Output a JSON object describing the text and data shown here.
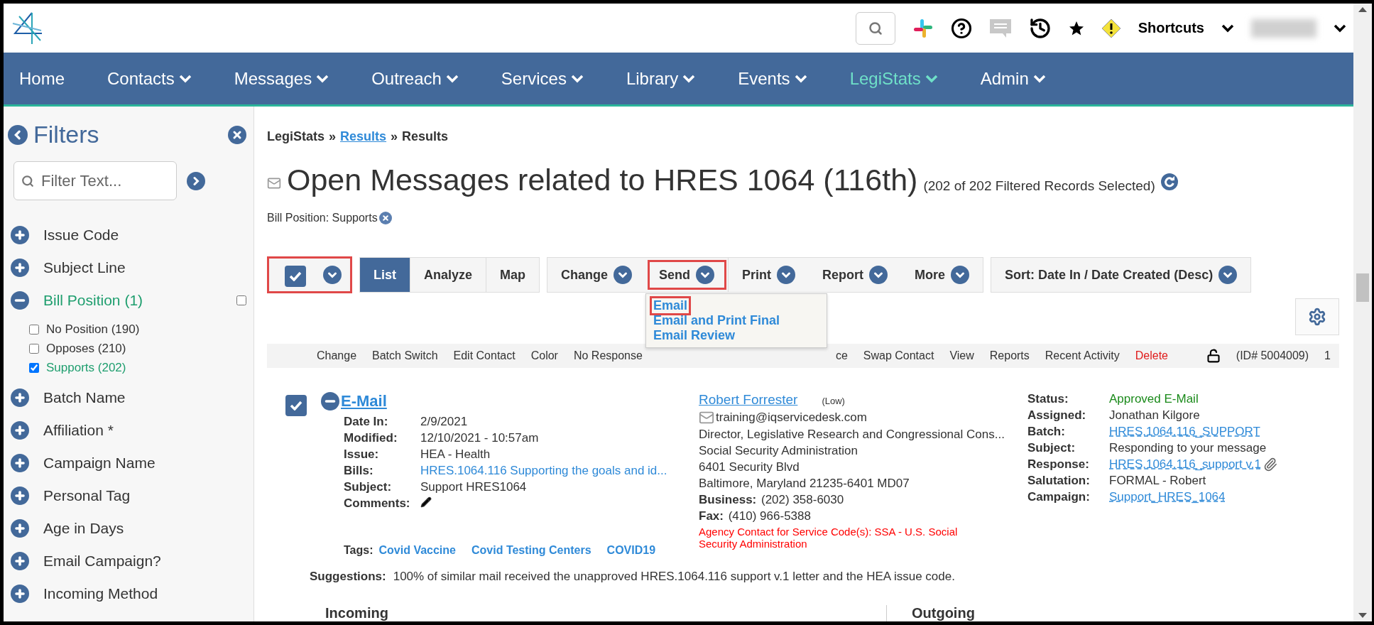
{
  "header": {
    "shortcuts": "Shortcuts"
  },
  "nav": [
    {
      "label": "Home",
      "dropdown": false,
      "selected": false
    },
    {
      "label": "Contacts",
      "dropdown": true,
      "selected": false
    },
    {
      "label": "Messages",
      "dropdown": true,
      "selected": false
    },
    {
      "label": "Outreach",
      "dropdown": true,
      "selected": false
    },
    {
      "label": "Services",
      "dropdown": true,
      "selected": false
    },
    {
      "label": "Library",
      "dropdown": true,
      "selected": false
    },
    {
      "label": "Events",
      "dropdown": true,
      "selected": false
    },
    {
      "label": "LegiStats",
      "dropdown": true,
      "selected": true
    },
    {
      "label": "Admin",
      "dropdown": true,
      "selected": false
    }
  ],
  "filters": {
    "title": "Filters",
    "placeholder": "Filter Text...",
    "items": [
      {
        "label": "Issue Code",
        "expanded": false
      },
      {
        "label": "Subject Line",
        "expanded": false
      },
      {
        "label": "Bill Position (1)",
        "expanded": true,
        "checked": false,
        "children": [
          {
            "label": "No Position (190)",
            "checked": false
          },
          {
            "label": "Opposes (210)",
            "checked": false
          },
          {
            "label": "Supports (202)",
            "checked": true
          }
        ]
      },
      {
        "label": "Batch Name",
        "expanded": false
      },
      {
        "label": "Affiliation *",
        "expanded": false
      },
      {
        "label": "Campaign Name",
        "expanded": false
      },
      {
        "label": "Personal Tag",
        "expanded": false
      },
      {
        "label": "Age in Days",
        "expanded": false
      },
      {
        "label": "Email Campaign?",
        "expanded": false
      },
      {
        "label": "Incoming Method",
        "expanded": false
      }
    ]
  },
  "breadcrumb": [
    {
      "kind": "text",
      "label": "LegiStats"
    },
    {
      "kind": "sep",
      "label": "»"
    },
    {
      "kind": "link",
      "label": "Results"
    },
    {
      "kind": "sep",
      "label": "»"
    },
    {
      "kind": "text",
      "label": "Results"
    }
  ],
  "title": "Open Messages related to HRES 1064 (116th)",
  "count": "(202 of 202 Filtered Records Selected)",
  "active_filter": "Bill Position: Supports",
  "toolbar": {
    "select_all": {
      "checked": true,
      "highlighted": true
    },
    "views": [
      {
        "label": "List",
        "selected": true
      },
      {
        "label": "Analyze",
        "selected": false
      },
      {
        "label": "Map",
        "selected": false
      }
    ],
    "actions": [
      {
        "label": "Change",
        "highlighted": false,
        "open": false
      },
      {
        "label": "Send",
        "highlighted": true,
        "open": true
      },
      {
        "label": "Print",
        "highlighted": false,
        "open": false
      },
      {
        "label": "Report",
        "highlighted": false,
        "open": false
      },
      {
        "label": "More",
        "highlighted": false,
        "open": false
      }
    ],
    "sort": "Sort: Date In / Date Created (Desc)"
  },
  "send_menu": [
    {
      "label": "Email",
      "highlighted": true
    },
    {
      "label": "Email and Print Final",
      "highlighted": false
    },
    {
      "label": "Email Review",
      "highlighted": false
    }
  ],
  "record_actions": [
    {
      "label": "Change",
      "kind": "link"
    },
    {
      "label": "Batch Switch",
      "kind": "link"
    },
    {
      "label": "Edit Contact",
      "kind": "link"
    },
    {
      "label": "Color",
      "kind": "link"
    },
    {
      "label": "No Response",
      "kind": "link"
    },
    {
      "label": "ce",
      "kind": "partial"
    },
    {
      "label": "Swap Contact",
      "kind": "link"
    },
    {
      "label": "View",
      "kind": "link"
    },
    {
      "label": "Reports",
      "kind": "link"
    },
    {
      "label": "Recent Activity",
      "kind": "link"
    },
    {
      "label": "Delete",
      "kind": "danger"
    }
  ],
  "record_id": "(ID# 5004009)",
  "record_count": "1",
  "record": {
    "checked": true,
    "type": "E-Mail",
    "details": [
      {
        "label": "Date In:",
        "value": "2/9/2021",
        "kind": "text"
      },
      {
        "label": "Modified:",
        "value": "12/10/2021 - 10:57am",
        "kind": "text"
      },
      {
        "label": "Issue:",
        "value": "HEA - Health",
        "kind": "text"
      },
      {
        "label": "Bills:",
        "value": "HRES.1064.116 Supporting the goals and id...",
        "kind": "link"
      },
      {
        "label": "Subject:",
        "value": "Support HRES1064",
        "kind": "text"
      },
      {
        "label": "Comments:",
        "kind": "edit"
      }
    ],
    "tags_label": "Tags:",
    "tags": [
      "Covid Vaccine",
      "Covid Testing Centers",
      "COVID19"
    ],
    "contact": {
      "name": "Robert Forrester",
      "priority": "(Low)",
      "email": "training@iqservicedesk.com",
      "lines": [
        "Director, Legislative Research and Congressional Cons...",
        "Social Security Administration",
        "6401 Security Blvd",
        "Baltimore, Maryland 21235-6401 MD07"
      ],
      "phones": [
        {
          "label": "Business:",
          "value": "(202) 358-6030"
        },
        {
          "label": "Fax:",
          "value": "(410) 966-5388"
        }
      ],
      "note": "Agency Contact for Service Code(s): SSA - U.S. Social Security Administration"
    },
    "status": [
      {
        "label": "Status:",
        "value": "Approved E-Mail",
        "kind": "status"
      },
      {
        "label": "Assigned:",
        "value": "Jonathan Kilgore",
        "kind": "text"
      },
      {
        "label": "Batch:",
        "value": "HRES.1064.116_SUPPORT",
        "kind": "link"
      },
      {
        "label": "Subject:",
        "value": "Responding to your message",
        "kind": "text"
      },
      {
        "label": "Response:",
        "value": "HRES.1064.116_support v.1",
        "kind": "attachment"
      },
      {
        "label": "Salutation:",
        "value": "FORMAL - Robert",
        "kind": "text"
      },
      {
        "label": "Campaign:",
        "value": "Support_HRES_1064",
        "kind": "link"
      }
    ],
    "suggestions_label": "Suggestions:",
    "suggestions": "100% of similar mail received the unapproved HRES.1064.116 support v.1 letter and the HEA issue code."
  },
  "sections": [
    "Incoming",
    "Outgoing"
  ]
}
